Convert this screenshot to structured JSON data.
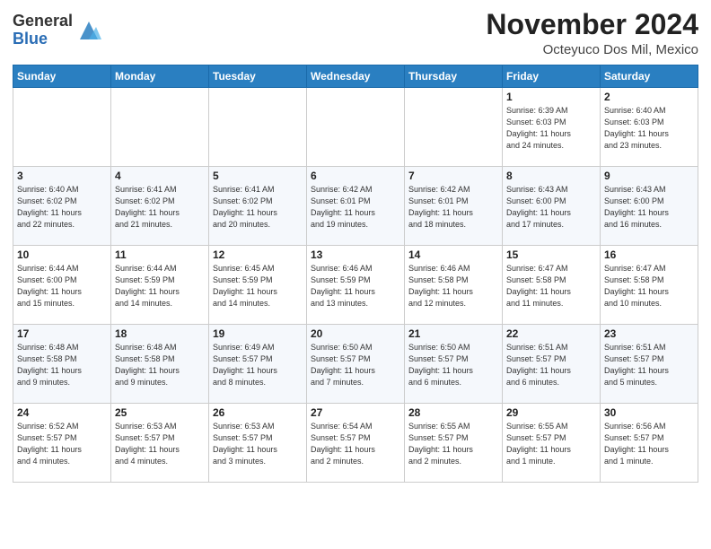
{
  "header": {
    "logo_general": "General",
    "logo_blue": "Blue",
    "month_title": "November 2024",
    "location": "Octeyuco Dos Mil, Mexico"
  },
  "weekdays": [
    "Sunday",
    "Monday",
    "Tuesday",
    "Wednesday",
    "Thursday",
    "Friday",
    "Saturday"
  ],
  "weeks": [
    [
      {
        "day": "",
        "info": ""
      },
      {
        "day": "",
        "info": ""
      },
      {
        "day": "",
        "info": ""
      },
      {
        "day": "",
        "info": ""
      },
      {
        "day": "",
        "info": ""
      },
      {
        "day": "1",
        "info": "Sunrise: 6:39 AM\nSunset: 6:03 PM\nDaylight: 11 hours\nand 24 minutes."
      },
      {
        "day": "2",
        "info": "Sunrise: 6:40 AM\nSunset: 6:03 PM\nDaylight: 11 hours\nand 23 minutes."
      }
    ],
    [
      {
        "day": "3",
        "info": "Sunrise: 6:40 AM\nSunset: 6:02 PM\nDaylight: 11 hours\nand 22 minutes."
      },
      {
        "day": "4",
        "info": "Sunrise: 6:41 AM\nSunset: 6:02 PM\nDaylight: 11 hours\nand 21 minutes."
      },
      {
        "day": "5",
        "info": "Sunrise: 6:41 AM\nSunset: 6:02 PM\nDaylight: 11 hours\nand 20 minutes."
      },
      {
        "day": "6",
        "info": "Sunrise: 6:42 AM\nSunset: 6:01 PM\nDaylight: 11 hours\nand 19 minutes."
      },
      {
        "day": "7",
        "info": "Sunrise: 6:42 AM\nSunset: 6:01 PM\nDaylight: 11 hours\nand 18 minutes."
      },
      {
        "day": "8",
        "info": "Sunrise: 6:43 AM\nSunset: 6:00 PM\nDaylight: 11 hours\nand 17 minutes."
      },
      {
        "day": "9",
        "info": "Sunrise: 6:43 AM\nSunset: 6:00 PM\nDaylight: 11 hours\nand 16 minutes."
      }
    ],
    [
      {
        "day": "10",
        "info": "Sunrise: 6:44 AM\nSunset: 6:00 PM\nDaylight: 11 hours\nand 15 minutes."
      },
      {
        "day": "11",
        "info": "Sunrise: 6:44 AM\nSunset: 5:59 PM\nDaylight: 11 hours\nand 14 minutes."
      },
      {
        "day": "12",
        "info": "Sunrise: 6:45 AM\nSunset: 5:59 PM\nDaylight: 11 hours\nand 14 minutes."
      },
      {
        "day": "13",
        "info": "Sunrise: 6:46 AM\nSunset: 5:59 PM\nDaylight: 11 hours\nand 13 minutes."
      },
      {
        "day": "14",
        "info": "Sunrise: 6:46 AM\nSunset: 5:58 PM\nDaylight: 11 hours\nand 12 minutes."
      },
      {
        "day": "15",
        "info": "Sunrise: 6:47 AM\nSunset: 5:58 PM\nDaylight: 11 hours\nand 11 minutes."
      },
      {
        "day": "16",
        "info": "Sunrise: 6:47 AM\nSunset: 5:58 PM\nDaylight: 11 hours\nand 10 minutes."
      }
    ],
    [
      {
        "day": "17",
        "info": "Sunrise: 6:48 AM\nSunset: 5:58 PM\nDaylight: 11 hours\nand 9 minutes."
      },
      {
        "day": "18",
        "info": "Sunrise: 6:48 AM\nSunset: 5:58 PM\nDaylight: 11 hours\nand 9 minutes."
      },
      {
        "day": "19",
        "info": "Sunrise: 6:49 AM\nSunset: 5:57 PM\nDaylight: 11 hours\nand 8 minutes."
      },
      {
        "day": "20",
        "info": "Sunrise: 6:50 AM\nSunset: 5:57 PM\nDaylight: 11 hours\nand 7 minutes."
      },
      {
        "day": "21",
        "info": "Sunrise: 6:50 AM\nSunset: 5:57 PM\nDaylight: 11 hours\nand 6 minutes."
      },
      {
        "day": "22",
        "info": "Sunrise: 6:51 AM\nSunset: 5:57 PM\nDaylight: 11 hours\nand 6 minutes."
      },
      {
        "day": "23",
        "info": "Sunrise: 6:51 AM\nSunset: 5:57 PM\nDaylight: 11 hours\nand 5 minutes."
      }
    ],
    [
      {
        "day": "24",
        "info": "Sunrise: 6:52 AM\nSunset: 5:57 PM\nDaylight: 11 hours\nand 4 minutes."
      },
      {
        "day": "25",
        "info": "Sunrise: 6:53 AM\nSunset: 5:57 PM\nDaylight: 11 hours\nand 4 minutes."
      },
      {
        "day": "26",
        "info": "Sunrise: 6:53 AM\nSunset: 5:57 PM\nDaylight: 11 hours\nand 3 minutes."
      },
      {
        "day": "27",
        "info": "Sunrise: 6:54 AM\nSunset: 5:57 PM\nDaylight: 11 hours\nand 2 minutes."
      },
      {
        "day": "28",
        "info": "Sunrise: 6:55 AM\nSunset: 5:57 PM\nDaylight: 11 hours\nand 2 minutes."
      },
      {
        "day": "29",
        "info": "Sunrise: 6:55 AM\nSunset: 5:57 PM\nDaylight: 11 hours\nand 1 minute."
      },
      {
        "day": "30",
        "info": "Sunrise: 6:56 AM\nSunset: 5:57 PM\nDaylight: 11 hours\nand 1 minute."
      }
    ]
  ]
}
